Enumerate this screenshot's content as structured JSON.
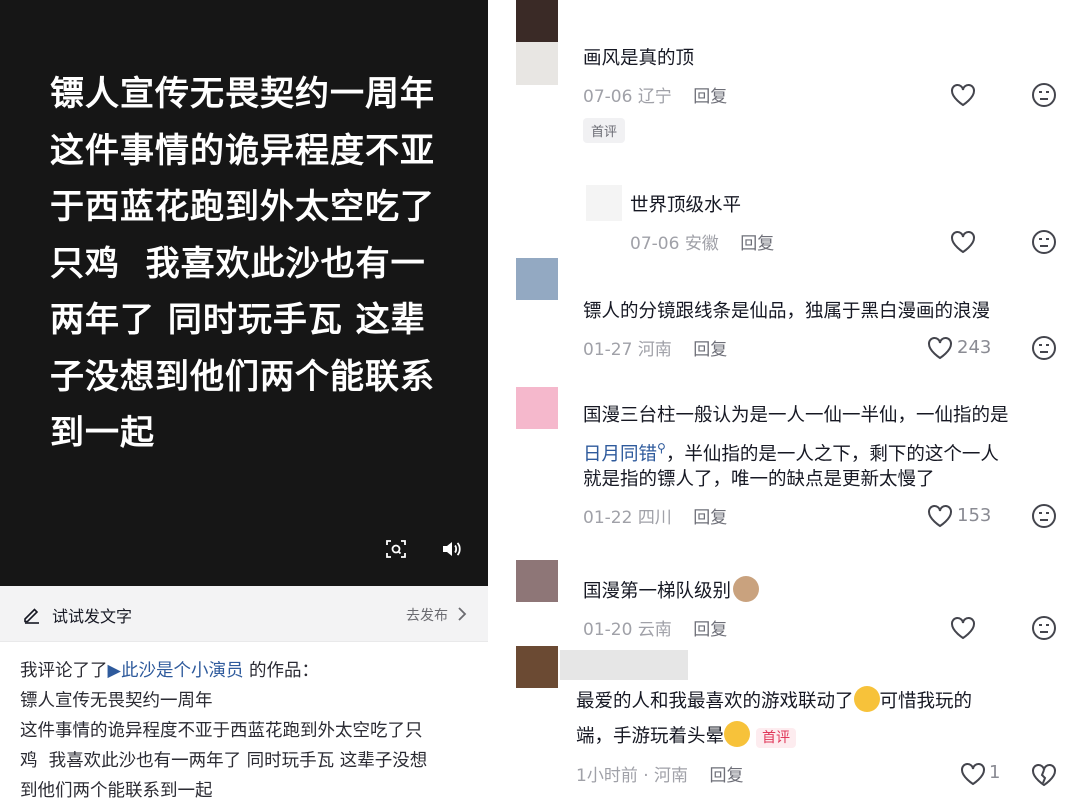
{
  "video": {
    "lines": [
      "镖人宣传无畏契约一周年",
      "这件事情的诡异程度不亚",
      "于西蓝花跑到外太空吃了",
      "只鸡  我喜欢此沙也有一",
      "两年了 同时玩手瓦 这辈",
      "子没想到他们两个能联系",
      "到一起"
    ],
    "controls": [
      "scan-icon",
      "volume-icon"
    ]
  },
  "compose_bar": {
    "placeholder": "试试发文字",
    "action": "去发布"
  },
  "shared_post": {
    "prefix": "我评论了了",
    "author_link": "▶此沙是个小演员",
    "suffix": " 的作品：",
    "lines": [
      "镖人宣传无畏契约一周年",
      "这件事情的诡异程度不亚于西蓝花跑到外太空吃了只",
      "鸡  我喜欢此沙也有一两年了 同时玩手瓦 这辈子没想",
      "到他们两个能联系到一起"
    ]
  },
  "comments": [
    {
      "text": "画风是真的顶",
      "date": "07-06",
      "region": "辽宁",
      "reply": "回复",
      "tag": "首评",
      "likes": "",
      "avatar_color": "#3a2a26"
    },
    {
      "text": "世界顶级水平",
      "date": "07-06",
      "region": "安徽",
      "reply": "回复",
      "likes": "",
      "avatar_color": "#e8e6e3"
    },
    {
      "text": "镖人的分镜跟线条是仙品，独属于黑白漫画的浪漫",
      "date": "01-27",
      "region": "河南",
      "reply": "回复",
      "likes": "243",
      "avatar_color": "#93a9c2"
    },
    {
      "lines": [
        "国漫三台柱一般认为是一人一仙一半仙，一仙指的是",
        "，半仙指的是一人之下，剩下的这个一人",
        "就是指的镖人了，唯一的缺点是更新太慢了"
      ],
      "link": "日月同错",
      "date": "01-22",
      "region": "四川",
      "reply": "回复",
      "likes": "153",
      "avatar_color": "#f5b8cc"
    },
    {
      "text": "国漫第一梯队级别",
      "date": "01-20",
      "region": "云南",
      "reply": "回复",
      "likes": "",
      "avatar_color": "#8e7677"
    },
    {
      "lines": [
        "最爱的人和我最喜欢的游戏联动了",
        "可惜我玩的",
        "端，手游玩着头晕"
      ],
      "tag": "首评",
      "date": "1小时前",
      "region": "河南",
      "reply": "回复",
      "likes": "1",
      "avatar_color": "#6b4a33"
    }
  ],
  "colors": {
    "video_bg": "#161616",
    "link": "#2e5a9c",
    "meta": "#a0a1a8",
    "tag_red": "#e0385a"
  }
}
